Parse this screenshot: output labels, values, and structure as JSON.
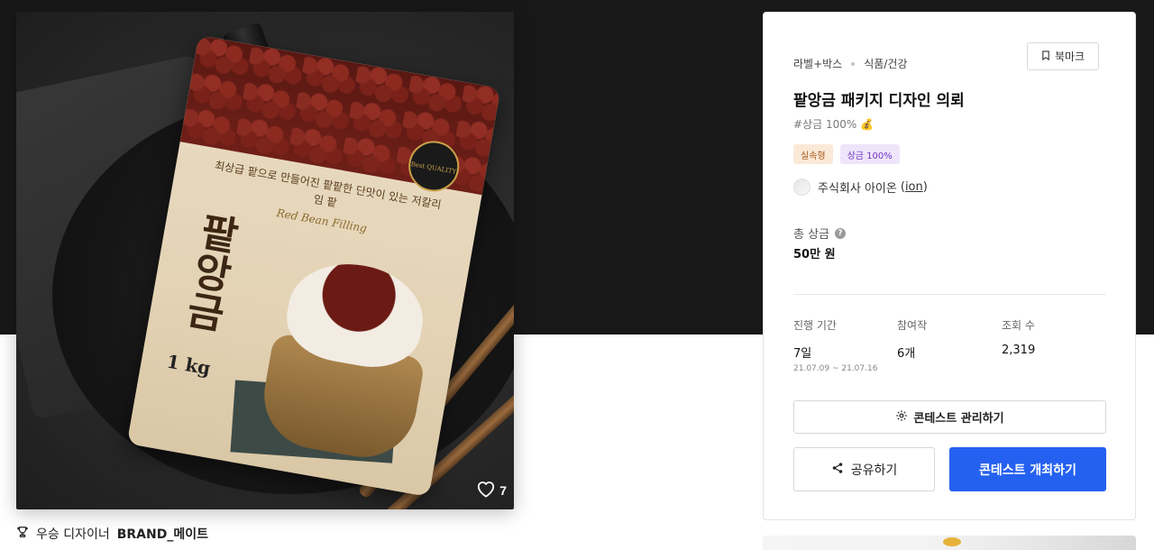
{
  "product_image": {
    "alt": "팥앙금 1kg 패키지",
    "likes": "7",
    "package_name": "팥앙금",
    "package_weight": "1 kg",
    "package_tagline": "최상급 팥으로 만들어진 팥팥한 단맛이 있는 저칼리임 팥",
    "package_english": "Red Bean Filling",
    "badge_text": "Best QUALITY"
  },
  "winner": {
    "prefix": "우승 디자이너",
    "name": "BRAND_메이트"
  },
  "contest": {
    "category_main": "라벨+박스",
    "category_sub": "식품/건강",
    "bookmark_label": "북마크",
    "title": "팥앙금 패키지 디자인 의뢰",
    "hashtag": "#상금 100% 💰",
    "badges": {
      "type": "실속형",
      "prize": "상금 100%"
    },
    "company": "주식회사 아이온",
    "company_handle": "ion",
    "total_prize_label": "총 상금",
    "total_prize_value": "50만 원",
    "stats": {
      "period_label": "진행 기간",
      "period_value": "7일",
      "period_range": "21.07.09 ~ 21.07.16",
      "participants_label": "참여작",
      "participants_value": "6개",
      "views_label": "조회 수",
      "views_value": "2,319"
    },
    "manage_label": "콘테스트 관리하기",
    "share_label": "공유하기",
    "open_label": "콘테스트 개최하기"
  },
  "colors": {
    "primary": "#2561f0",
    "dark_band": "#181818",
    "badge_type_bg": "#fbe9d8",
    "badge_prize_bg": "#efe5fb"
  }
}
